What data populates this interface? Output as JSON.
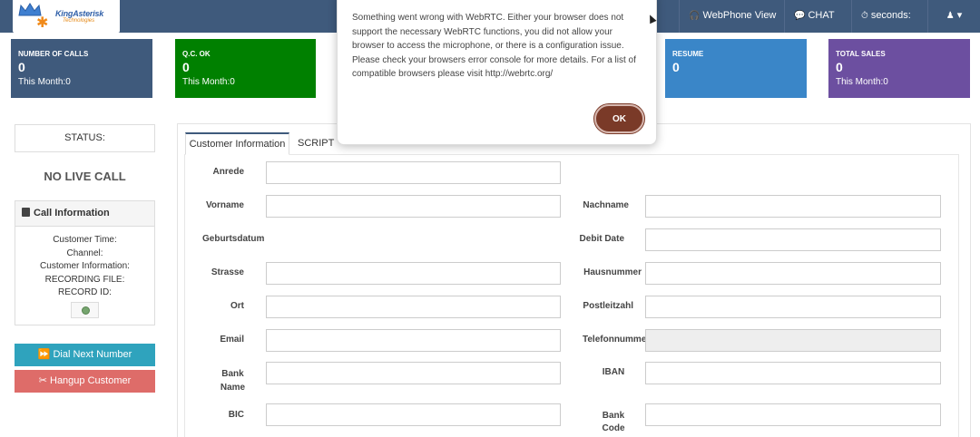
{
  "brand": {
    "name": "KingAsterisk",
    "sub": "Technologies"
  },
  "nav": {
    "partial_item": "w",
    "webphone_label": "WebPhone View",
    "chat_label": "CHAT",
    "seconds_label": "seconds:",
    "user_caret": "▾"
  },
  "cards": [
    {
      "title": "NUMBER OF CALLS",
      "value": "0",
      "month": "This Month:0",
      "color": "#3f5a7c"
    },
    {
      "title": "Q.C. OK",
      "value": "0",
      "month": "This Month:0",
      "color": "#008000"
    },
    {
      "title": "RESUME",
      "value": "0",
      "month": "",
      "color": "#3a86c8"
    },
    {
      "title": "TOTAL SALES",
      "value": "0",
      "month": "This Month:0",
      "color": "#6c4fa0"
    }
  ],
  "left": {
    "status_label": "STATUS:",
    "no_live_call": "NO LIVE CALL",
    "call_info_title": "Call Information",
    "call_info_lines": [
      "Customer Time:",
      "Channel:",
      "Customer Information:",
      "RECORDING FILE:",
      "RECORD ID:"
    ],
    "dial_next": "Dial Next Number",
    "hangup": "Hangup Customer"
  },
  "tabs": {
    "customer_info": "Customer Information",
    "script": "SCRIPT"
  },
  "form": {
    "anrede": "Anrede",
    "vorname": "Vorname",
    "nachname": "Nachname",
    "geburtsdatum": "Geburtsdatum",
    "debit_date": "Debit Date",
    "strasse": "Strasse",
    "hausnummer": "Hausnummer",
    "ort": "Ort",
    "postleitzahl": "Postleitzahl",
    "email": "Email",
    "telefonnummer": "Telefonnumme",
    "bank_name_1": "Bank",
    "bank_name_2": "Name",
    "iban": "IBAN",
    "bic": "BIC",
    "bank_code_1": "Bank",
    "bank_code_2": "Code"
  },
  "modal": {
    "message": "Something went wrong with WebRTC. Either your browser does not support the necessary WebRTC functions, you did not allow your browser to access the microphone, or there is a configuration issue. Please check your browsers error console for more details. For a list of compatible browsers please visit http://webrtc.org/",
    "ok_label": "OK"
  }
}
